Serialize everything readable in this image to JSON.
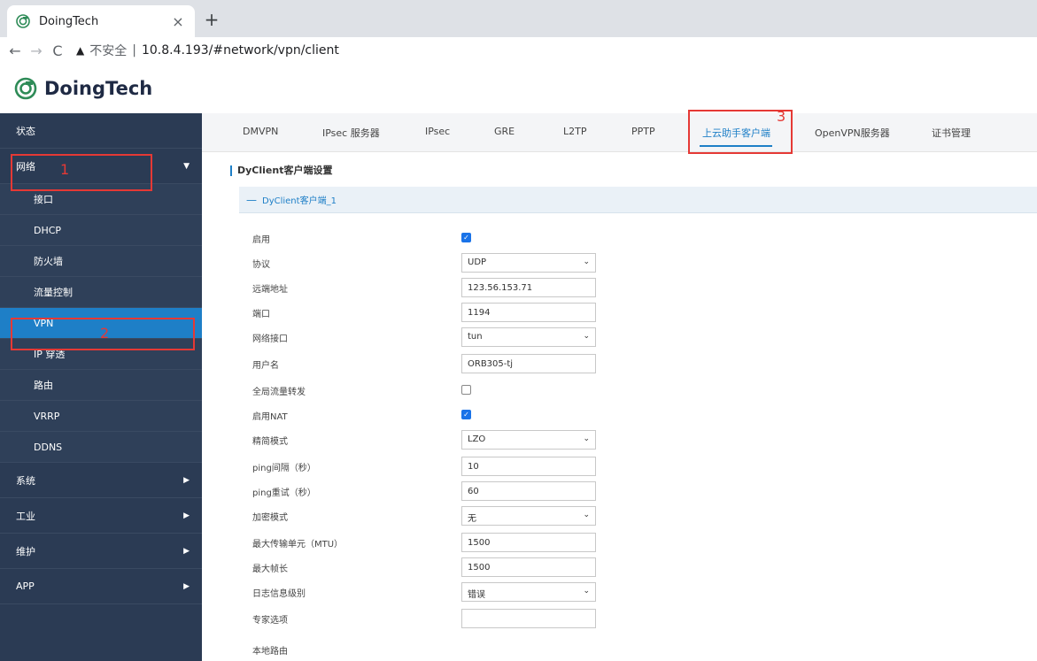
{
  "browser": {
    "tab_title": "DoingTech",
    "tab_close": "×",
    "new_tab": "+",
    "back": "←",
    "forward": "→",
    "reload": "C",
    "warning": "▲",
    "insecure": "不安全",
    "sep": "|",
    "url": "10.8.4.193/#network/vpn/client"
  },
  "app": {
    "logo_text": "DoingTech",
    "brand_color": "#1e7fc7"
  },
  "sidebar": {
    "items": [
      {
        "label": "状态"
      },
      {
        "label": "网络"
      },
      {
        "label": "接口"
      },
      {
        "label": "DHCP"
      },
      {
        "label": "防火墙"
      },
      {
        "label": "流量控制"
      },
      {
        "label": "VPN"
      },
      {
        "label": "IP 穿透"
      },
      {
        "label": "路由"
      },
      {
        "label": "VRRP"
      },
      {
        "label": "DDNS"
      },
      {
        "label": "系统"
      },
      {
        "label": "工业"
      },
      {
        "label": "维护"
      },
      {
        "label": "APP"
      }
    ]
  },
  "tabs": {
    "items": [
      {
        "label": "DMVPN"
      },
      {
        "label": "IPsec 服务器"
      },
      {
        "label": "IPsec"
      },
      {
        "label": "GRE"
      },
      {
        "label": "L2TP"
      },
      {
        "label": "PPTP"
      },
      {
        "label": "上云助手客户端"
      },
      {
        "label": "OpenVPN服务器"
      },
      {
        "label": "证书管理"
      }
    ]
  },
  "content": {
    "section_title": "DyClient客户端设置",
    "group_minus": "—",
    "group_label": "DyClient客户端_1",
    "fields": {
      "enable": {
        "label": "启用",
        "checked": true
      },
      "protocol": {
        "label": "协议",
        "value": "UDP"
      },
      "remote": {
        "label": "远端地址",
        "value": "123.56.153.71"
      },
      "port": {
        "label": "端口",
        "value": "1194"
      },
      "netif": {
        "label": "网络接口",
        "value": "tun"
      },
      "username": {
        "label": "用户名",
        "value": "ORB305-tj"
      },
      "global": {
        "label": "全局流量转发",
        "checked": false
      },
      "nat": {
        "label": "启用NAT",
        "checked": true
      },
      "compress": {
        "label": "精简模式",
        "value": "LZO"
      },
      "ping_interval": {
        "label": "ping间隔（秒）",
        "value": "10"
      },
      "ping_retry": {
        "label": "ping重试（秒）",
        "value": "60"
      },
      "encrypt": {
        "label": "加密模式",
        "value": "无"
      },
      "mtu": {
        "label": "最大传输单元（MTU）",
        "value": "1500"
      },
      "max_frame": {
        "label": "最大帧长",
        "value": "1500"
      },
      "log_level": {
        "label": "日志信息级别",
        "value": "错误"
      },
      "expert": {
        "label": "专家选项",
        "value": ""
      }
    },
    "local_route": "本地路由"
  },
  "annotations": {
    "one": "1",
    "two": "2",
    "three": "3",
    "color": "#e53935"
  }
}
